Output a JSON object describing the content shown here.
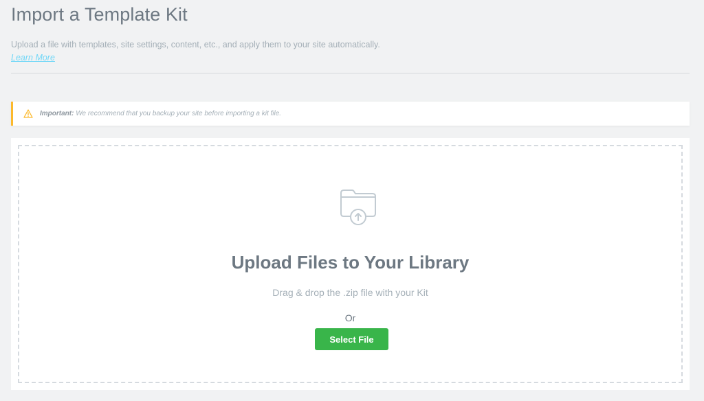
{
  "header": {
    "title": "Import a Template Kit",
    "subtitle": "Upload a file with templates, site settings, content, etc., and apply them to your site automatically.",
    "learn_more": "Learn More"
  },
  "notice": {
    "icon": "warning-icon",
    "label": "Important:",
    "text": "We recommend that you backup your site before importing a kit file.",
    "accent_color": "#fcb92c"
  },
  "upload": {
    "icon": "folder-upload-icon",
    "title": "Upload Files to Your Library",
    "description": "Drag & drop the .zip file with your Kit",
    "or": "Or",
    "button_label": "Select File",
    "button_color": "#39b54a"
  }
}
